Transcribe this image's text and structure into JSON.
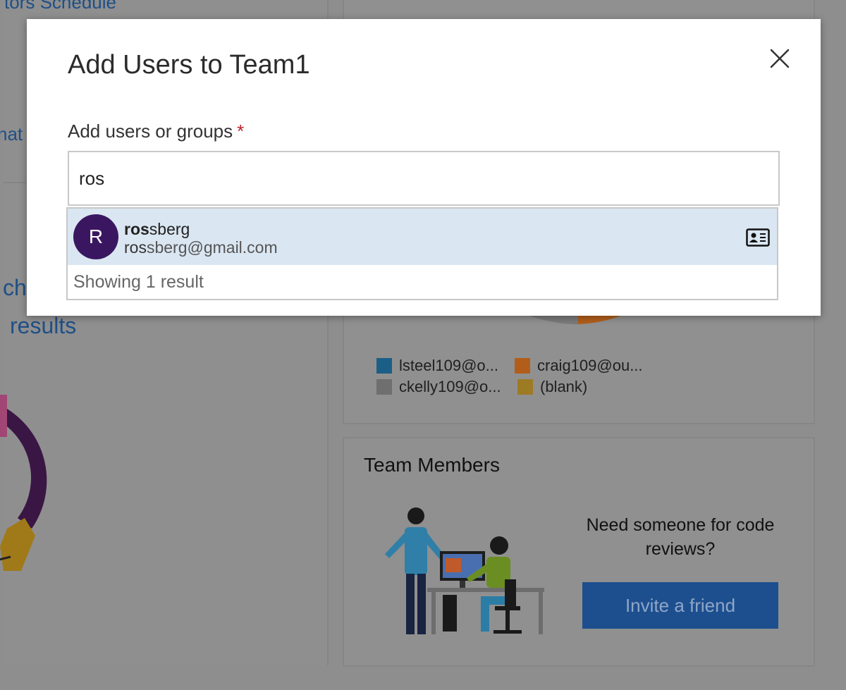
{
  "background": {
    "schedule_link": "tors Schedule",
    "side_link_fragment": "nat",
    "left_heading_line1": "ch",
    "left_heading_line2": "results",
    "legend": [
      {
        "label": "lsteel109@o...",
        "color": "#1b5f86"
      },
      {
        "label": "craig109@ou...",
        "color": "#b25e1a"
      },
      {
        "label": "ckelly109@o...",
        "color": "#6f6f6f"
      },
      {
        "label": "(blank)",
        "color": "#9d7a24"
      }
    ],
    "team_members": {
      "title": "Team Members",
      "prompt": "Need someone for code reviews?",
      "invite_label": "Invite a friend"
    }
  },
  "modal": {
    "title": "Add Users to Team1",
    "close_icon": "close-icon",
    "field_label": "Add users or groups",
    "required_marker": "*",
    "search_value": "ros",
    "suggestion": {
      "avatar_initial": "R",
      "name_match": "ros",
      "name_rest": "sberg",
      "email_match": "ros",
      "email_rest": "sberg@gmail.com",
      "contact_icon": "contact-card-icon"
    },
    "result_count": "Showing 1 result"
  },
  "colors": {
    "accent": "#1d4f8f",
    "avatar": "#3a1660",
    "highlight_row": "#dae6f1",
    "required": "#c0222a"
  }
}
